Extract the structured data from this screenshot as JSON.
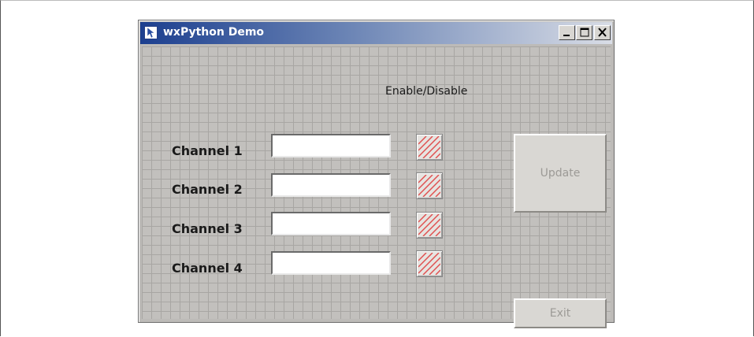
{
  "window": {
    "title": "wxPython Demo"
  },
  "panel": {
    "enable_header": "Enable/Disable",
    "channels": [
      {
        "label": "Channel 1",
        "value": ""
      },
      {
        "label": "Channel 2",
        "value": ""
      },
      {
        "label": "Channel 3",
        "value": ""
      },
      {
        "label": "Channel 4",
        "value": ""
      }
    ],
    "update_label": "Update",
    "exit_label": "Exit"
  },
  "colors": {
    "titlebar_start": "#1c3f8f",
    "toggle_stripe": "#e05050",
    "disabled_text": "#9c9a96"
  }
}
